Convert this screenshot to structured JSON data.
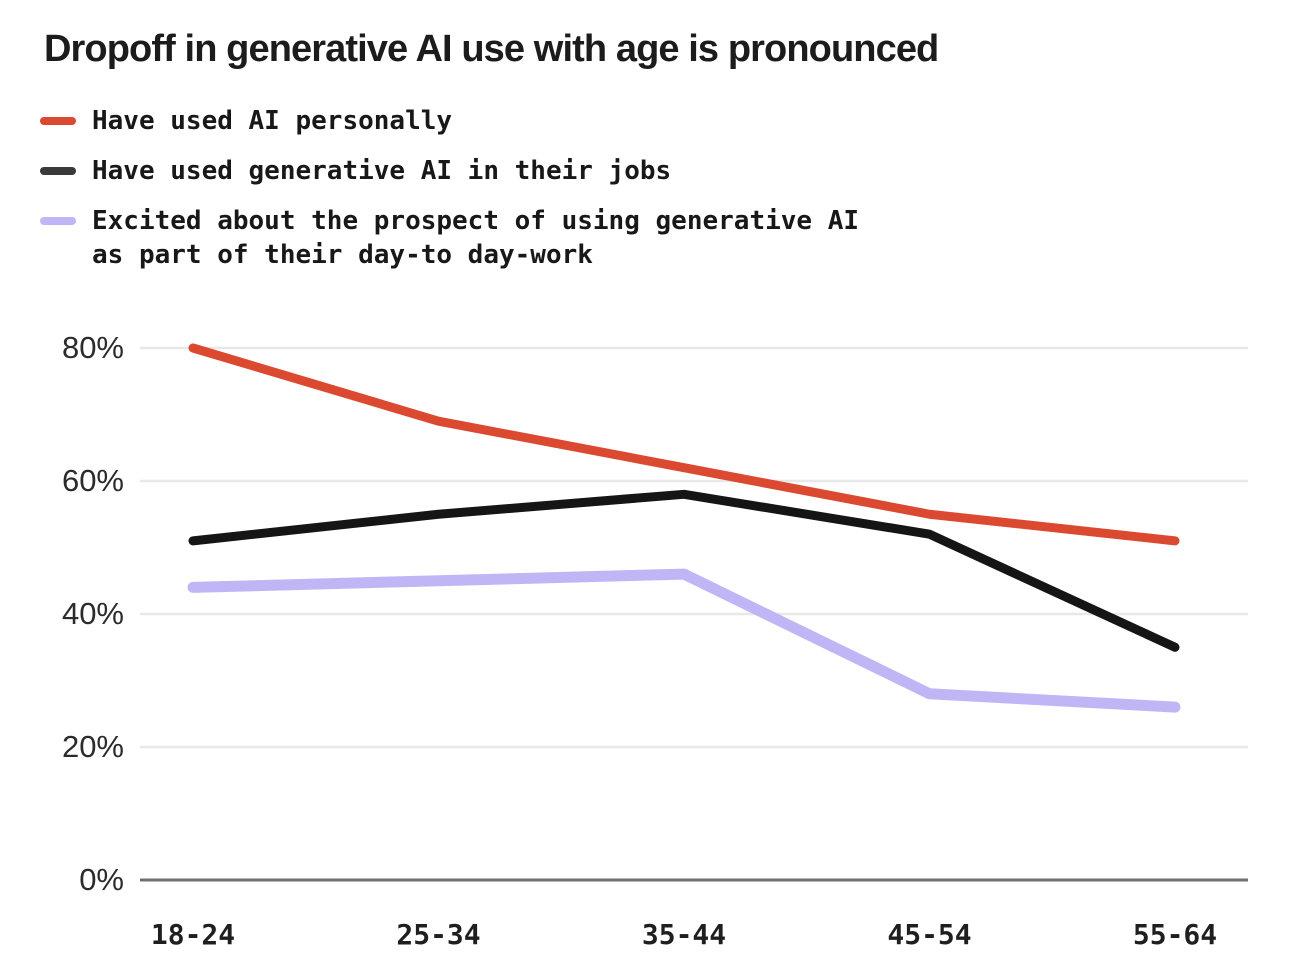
{
  "chart_data": {
    "type": "line",
    "title": "Dropoff in generative AI use with age is pronounced",
    "xlabel": "",
    "ylabel": "",
    "categories": [
      "18-24",
      "25-34",
      "35-44",
      "45-54",
      "55-64"
    ],
    "ylim": [
      0,
      88
    ],
    "yticks": [
      0,
      20,
      40,
      60,
      80
    ],
    "ytick_labels": [
      "0%",
      "20%",
      "40%",
      "60%",
      "80%"
    ],
    "grid": "horizontal",
    "legend_position": "above-plot",
    "series": [
      {
        "name": "Have used AI personally",
        "color": "#DB4A30",
        "values": [
          80,
          69,
          62,
          55,
          51
        ]
      },
      {
        "name": "Have used generative AI in their jobs",
        "color": "#151515",
        "values": [
          51,
          55,
          58,
          52,
          35
        ]
      },
      {
        "name": "Excited about the prospect of using generative AI\nas part of their day-to day-work",
        "color": "#C0B6F6",
        "values": [
          44,
          45,
          46,
          28,
          26
        ]
      }
    ]
  },
  "colors": {
    "background": "#ffffff",
    "title_text": "#1c1c1c",
    "gridline": "#e8e8e8",
    "axis_line": "#6f6f6f",
    "red": "#DB4A30",
    "black": "#151515",
    "lavender": "#C0B6F6"
  },
  "legend": [
    {
      "label": "Have used AI personally",
      "color": "#DB4A30"
    },
    {
      "label": "Have used generative AI in their jobs",
      "color": "#151515"
    },
    {
      "label": "Excited about the prospect of using generative AI\nas part of their day-to day-work",
      "color": "#C0B6F6"
    }
  ],
  "y_ticks": [
    "80%",
    "60%",
    "40%",
    "20%",
    "0%"
  ],
  "x_ticks": [
    "18-24",
    "25-34",
    "35-44",
    "45-54",
    "55-64"
  ]
}
